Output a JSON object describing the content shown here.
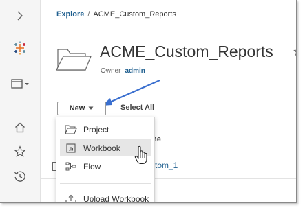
{
  "breadcrumb": {
    "root": "Explore",
    "separator": "/",
    "current": "ACME_Custom_Reports"
  },
  "project": {
    "title": "ACME_Custom_Reports",
    "owner_label": "Owner",
    "owner_value": "admin"
  },
  "toolbar": {
    "new_label": "New",
    "select_all_label": "Select All"
  },
  "background": {
    "column_header_fragment": "ne",
    "item_fragment": "stom_1"
  },
  "menu": {
    "items": [
      {
        "label": "Project",
        "icon": "folder-open-icon"
      },
      {
        "label": "Workbook",
        "icon": "workbook-icon"
      },
      {
        "label": "Flow",
        "icon": "flow-icon"
      },
      {
        "label": "Upload Workbook",
        "icon": "upload-icon"
      }
    ]
  },
  "colors": {
    "accent_link": "#1f5f8f",
    "annotation_arrow": "#3a6fcf",
    "menu_hover": "#e6e6e6"
  }
}
